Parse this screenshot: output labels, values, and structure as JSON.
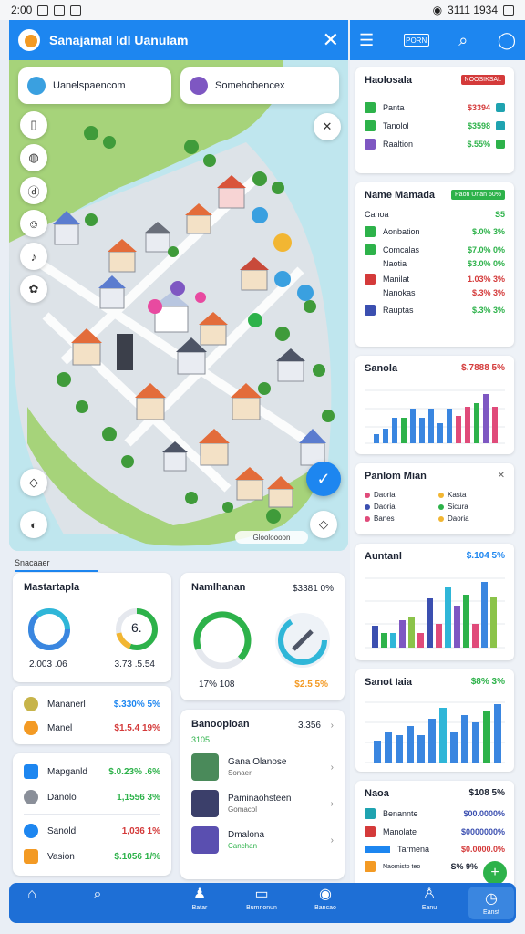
{
  "status": {
    "time": "2:00",
    "right_text": "3111 1934"
  },
  "map": {
    "title": "Sanajamal ldl Uanulam",
    "close_icon": "close-icon",
    "card_left": "Uanelspaencom",
    "card_right": "Somehobencex",
    "attribution": "Glooloooon",
    "fab_icon": "check-icon"
  },
  "right": {
    "header_flag": "PORN",
    "card1": {
      "title": "Haolosala",
      "tag": "NOOSIKSAL",
      "rows": [
        {
          "label": "Panta",
          "val": "$3394",
          "color": "#2db24a"
        },
        {
          "label": "Tanolol",
          "val": "$3598",
          "color": "#2db24a"
        },
        {
          "label": "Raaltion",
          "val": "$.55%",
          "color": "#2db24a"
        }
      ]
    },
    "card2": {
      "title": "Name Mamada",
      "tag": "Paon Unan 60%",
      "rows": [
        {
          "label": "Canoa",
          "val": "S5",
          "color": "#2db24a"
        },
        {
          "label": "Aonbation",
          "val": "$.0% 3%",
          "color": "#2db24a"
        },
        {
          "label": "Comcalas",
          "val": "$7.0% 0%",
          "color": "#2db24a"
        },
        {
          "label": "Naotia",
          "val": "$3.0% 0%",
          "color": "#2db24a"
        },
        {
          "label": "Manilat",
          "val": "1.03% 3%",
          "color": "#d43a3a"
        },
        {
          "label": "Nanokas",
          "val": "$.3% 3%",
          "color": "#d43a3a"
        },
        {
          "label": "Rauptas",
          "val": "$.3% 3%",
          "color": "#2db24a"
        }
      ]
    },
    "chart1": {
      "title": "Sanola",
      "value": "$.7888 5%"
    },
    "legend": {
      "title": "Panlom Mian",
      "items": [
        "Daoria",
        "Kasta",
        "Daoria",
        "Sicura",
        "Banes",
        "Daoria"
      ]
    },
    "chart2": {
      "title": "Auntanl",
      "value": "$.104 5%"
    },
    "chart3": {
      "title": "Sanot Iaia",
      "value": "$8% 3%"
    },
    "card_last": {
      "title": "Naoa",
      "value": "$108 5%",
      "rows": [
        {
          "label": "Benannte",
          "val": "$00.0000%"
        },
        {
          "label": "Manolate",
          "val": "$0000000%"
        },
        {
          "label": "Tarmena",
          "val": "$0.0000.0%"
        },
        {
          "label": "Naomisto teo",
          "val": "S% 9%"
        }
      ],
      "fab": "+"
    }
  },
  "stats": {
    "section_label": "Snacaaer",
    "card_a": {
      "title": "Mastartapla",
      "left_val": "2.003 .06",
      "right_val": "3.73 .5.54",
      "gauge_label": "6."
    },
    "card_b": {
      "title": "Namlhanan",
      "value": "$3381 0%",
      "left_val": "17% 108",
      "right_val": "$2.5 5%"
    },
    "coins": [
      {
        "label": "Mananerl",
        "val": "$.330% 5%"
      },
      {
        "label": "Manel",
        "val": "$1.5.4 19%"
      }
    ],
    "card_c_rows": [
      {
        "label": "Mapganld",
        "val": "$.0.23% .6%",
        "color": "#2db24a"
      },
      {
        "label": "Danolo",
        "val": "1,1556 3%",
        "color": "#2db24a"
      },
      {
        "label": "Sanold",
        "val": "1,036 1%",
        "color": "#d43a3a"
      },
      {
        "label": "Vasion",
        "val": "$.1056 1/%",
        "color": "#2db24a"
      }
    ],
    "list": {
      "title": "Banooploan",
      "value": "3.356",
      "sub": "3105",
      "items": [
        {
          "name": "Gana Olanose",
          "sub": "Sonaer"
        },
        {
          "name": "Paminaohsteen",
          "sub": "Gomacol"
        },
        {
          "name": "Dmalona",
          "sub": "Canchan"
        }
      ]
    }
  },
  "nav": {
    "items": [
      "Batar",
      "Bumnonun",
      "Bancao",
      "Eanu",
      "Eanst"
    ]
  }
}
